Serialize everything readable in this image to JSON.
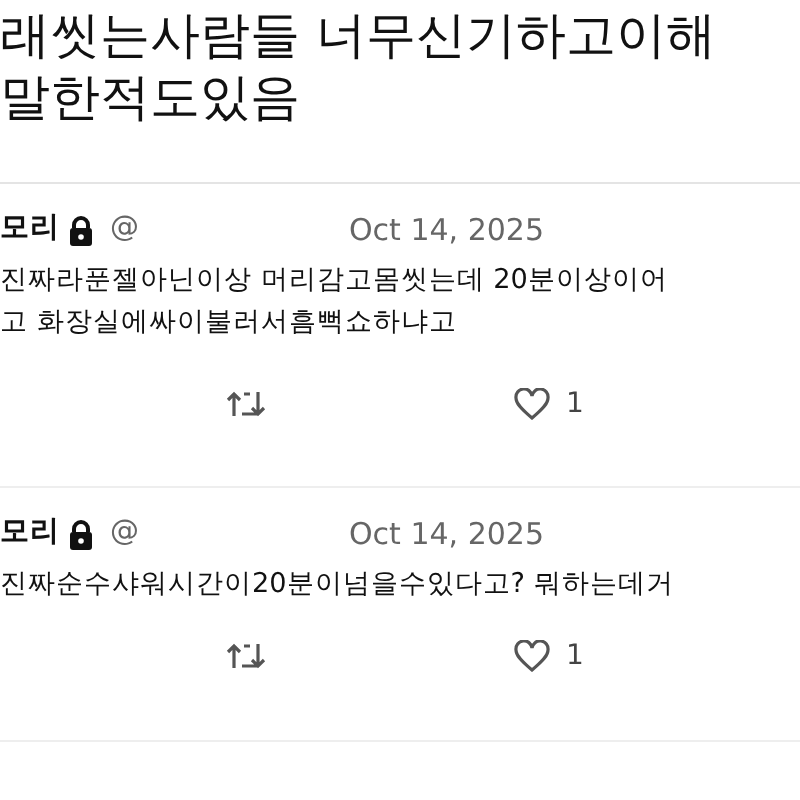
{
  "post_text": [
    "래씻는사람들 너무신기하고이해",
    "말한적도있음"
  ],
  "replies": [
    {
      "author": "모리",
      "locked": true,
      "handle": "@",
      "date": "Oct 14, 2025",
      "text": [
        "진짜라푼젤아닌이상 머리감고몸씻는데 20분이상이어",
        "고 화장실에싸이불러서흠뻑쇼하냐고"
      ],
      "likes": "1"
    },
    {
      "author": "모리",
      "locked": true,
      "handle": "@",
      "date": "Oct 14, 2025",
      "text": [
        "진짜순수샤워시간이20분이넘을수있다고? 뭐하는데거"
      ],
      "likes": "1"
    }
  ]
}
